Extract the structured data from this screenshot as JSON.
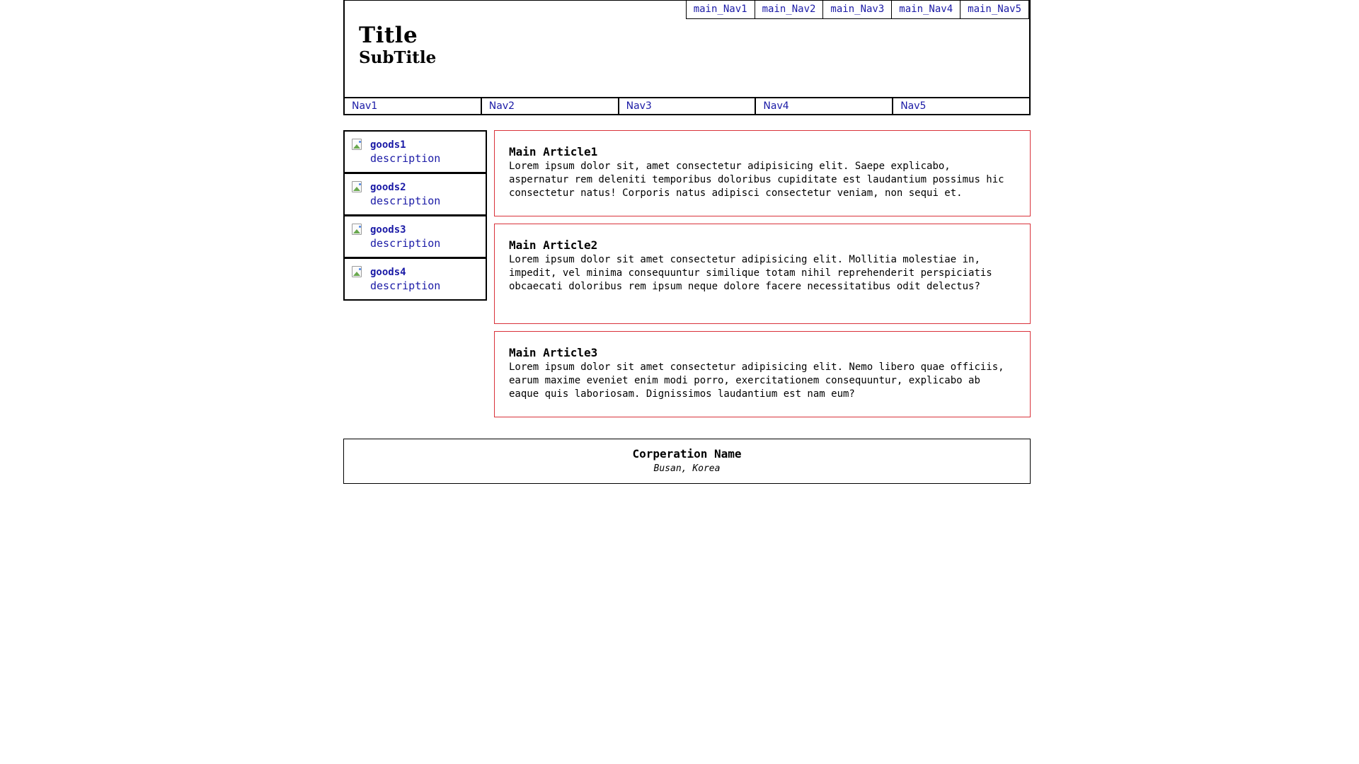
{
  "header": {
    "title": "Title",
    "subtitle": "SubTitle",
    "main_nav": [
      "main_Nav1",
      "main_Nav2",
      "main_Nav3",
      "main_Nav4",
      "main_Nav5"
    ],
    "nav": [
      "Nav1",
      "Nav2",
      "Nav3",
      "Nav4",
      "Nav5"
    ]
  },
  "aside": {
    "goods": [
      {
        "name": "goods1",
        "description": "description",
        "icon": "broken-image-icon"
      },
      {
        "name": "goods2",
        "description": "description",
        "icon": "broken-image-icon"
      },
      {
        "name": "goods3",
        "description": "description",
        "icon": "broken-image-icon"
      },
      {
        "name": "goods4",
        "description": "description",
        "icon": "broken-image-icon"
      }
    ]
  },
  "articles": [
    {
      "title": "Main Article1",
      "body": "Lorem ipsum dolor sit, amet consectetur adipisicing elit. Saepe explicabo, aspernatur rem deleniti temporibus doloribus cupiditate est laudantium possimus hic consectetur natus! Corporis natus adipisci consectetur veniam, non sequi et."
    },
    {
      "title": "Main Article2",
      "body": "Lorem ipsum dolor sit amet consectetur adipisicing elit. Mollitia molestiae in, impedit, vel minima consequuntur similique totam nihil reprehenderit perspiciatis obcaecati doloribus rem ipsum neque dolore facere necessitatibus odit delectus?"
    },
    {
      "title": "Main Article3",
      "body": "Lorem ipsum dolor sit amet consectetur adipisicing elit. Nemo libero quae officiis, earum maxime eveniet enim modi porro, exercitationem consequuntur, explicabo ab eaque quis laboriosam. Dignissimos laudantium est nam eum?"
    }
  ],
  "footer": {
    "corporation_name": "Corperation Name",
    "address": "Busan, Korea"
  },
  "colors": {
    "link": "#1a1aa6",
    "article_border": "#d9323a",
    "border": "#000000"
  }
}
